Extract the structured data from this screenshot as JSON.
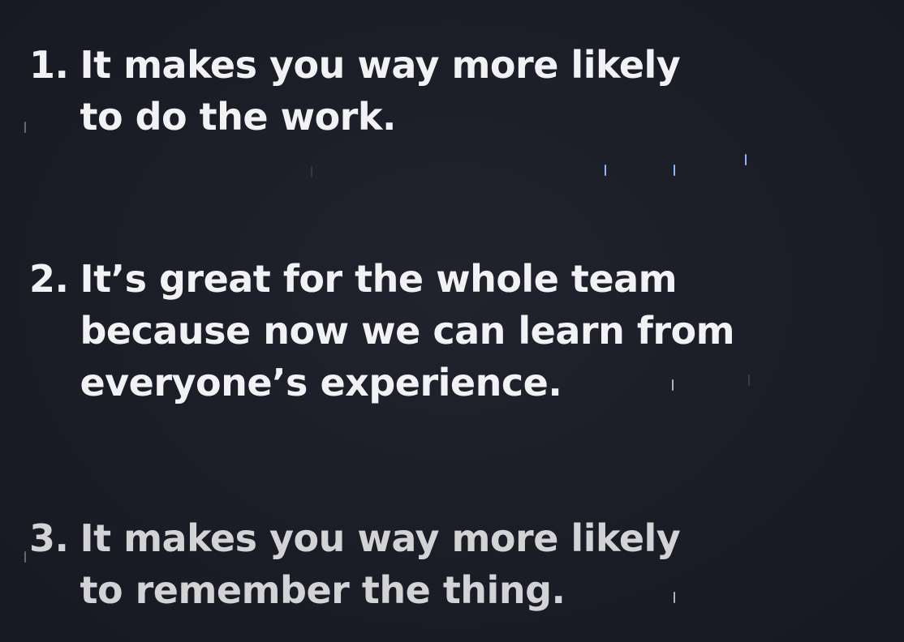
{
  "points": [
    {
      "number": "1.",
      "lines": [
        "It makes you way more likely",
        "to do the work."
      ]
    },
    {
      "number": "2.",
      "lines": [
        "It’s great for the whole team",
        "because now we can learn from",
        "everyone’s experience."
      ]
    },
    {
      "number": "3.",
      "lines": [
        "It makes you way more likely",
        "to remember the thing."
      ]
    }
  ],
  "colors": {
    "background": "#1b1d27",
    "text_primary": "#f2f2f4",
    "text_faded": "#d3d3d6",
    "accent_tick": "#8fb4ff"
  }
}
